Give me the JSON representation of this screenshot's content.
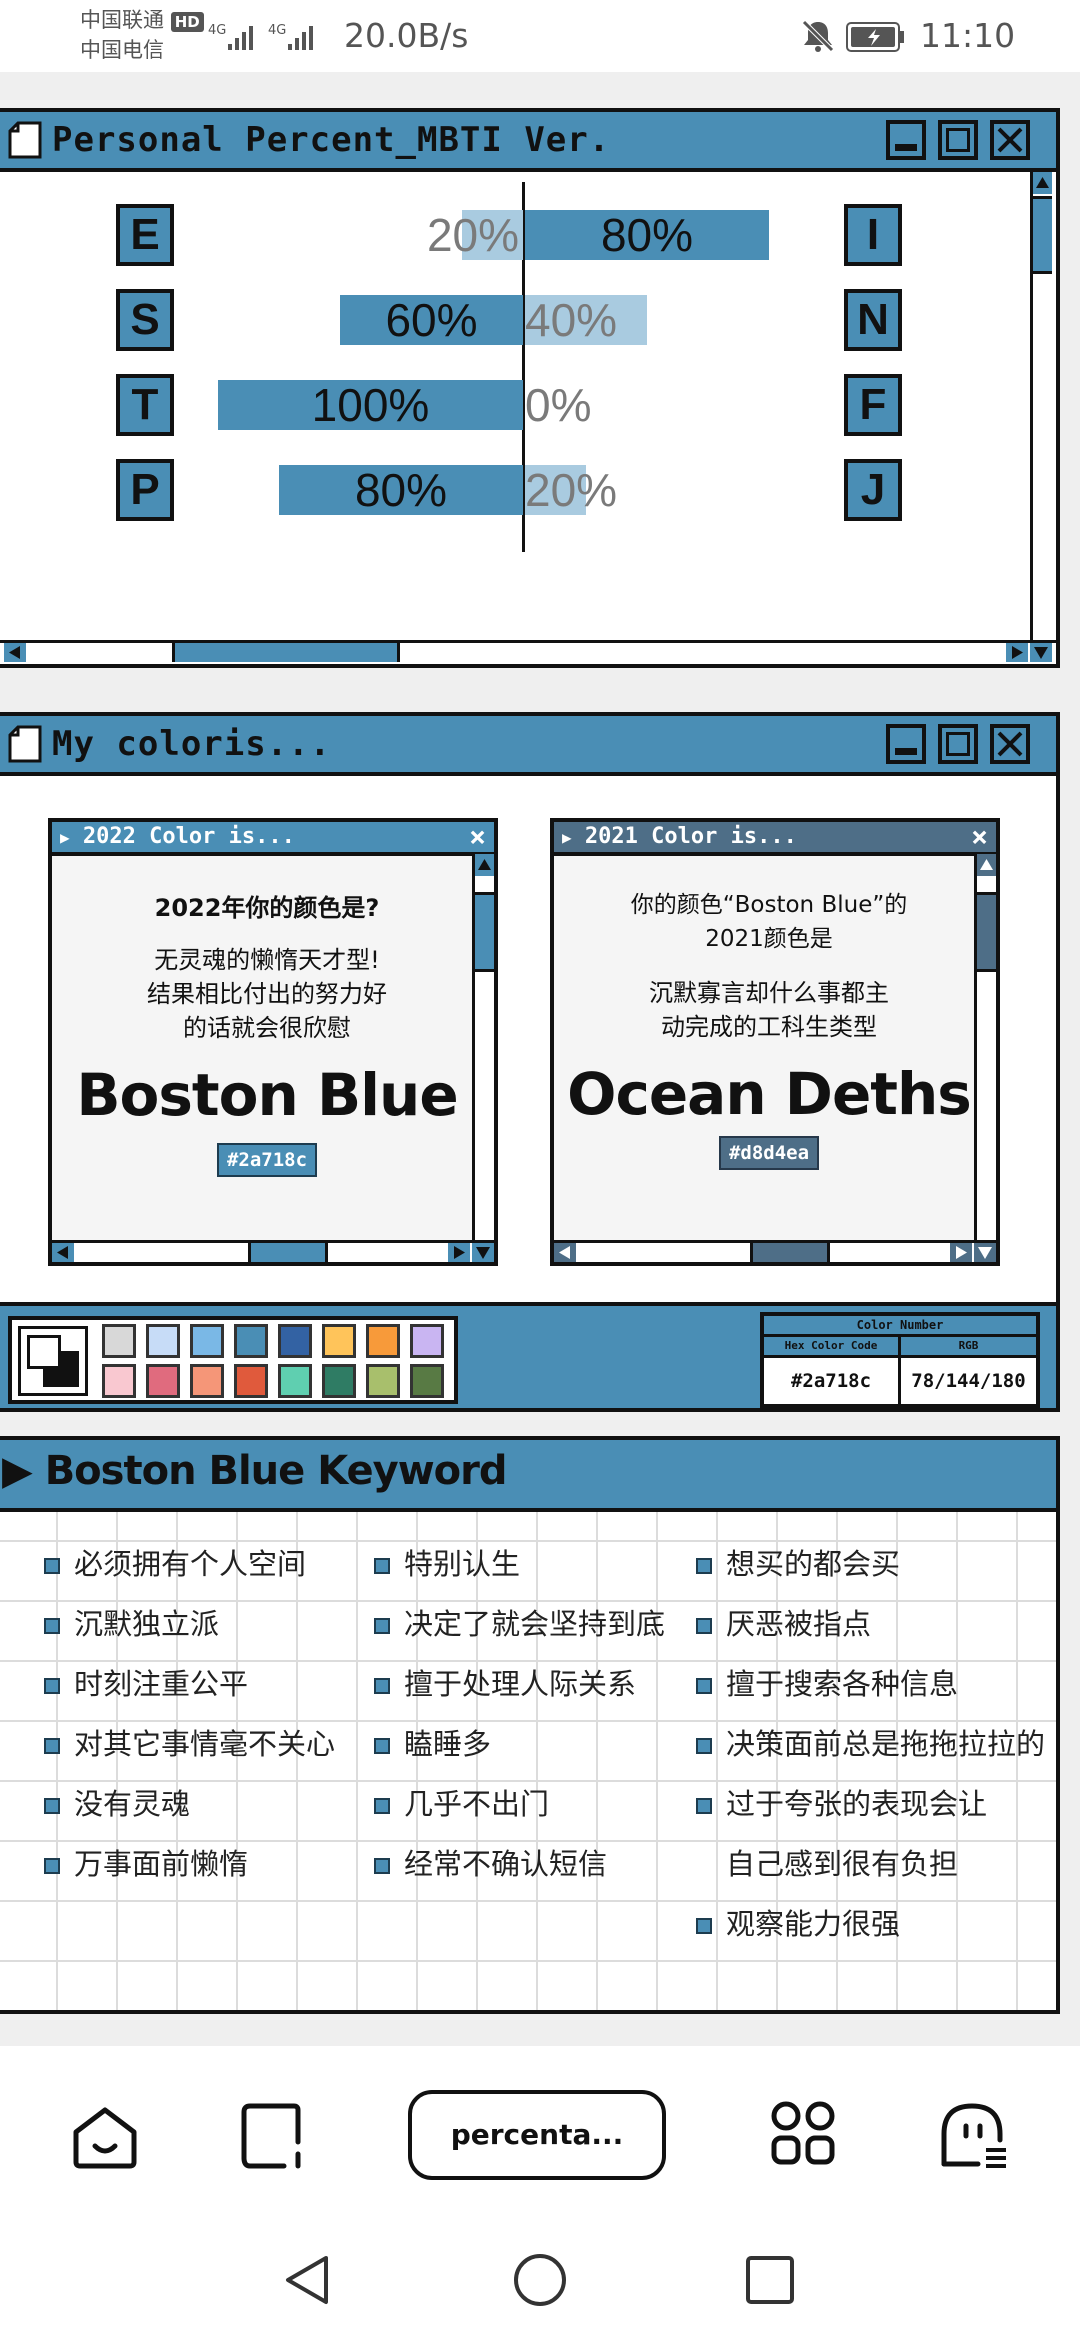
{
  "status_bar": {
    "carrier1": "中国联通",
    "hd": "HD",
    "carrier2": "中国电信",
    "net1": "4G",
    "net2": "4G",
    "speed": "20.0B/s",
    "time": "11:10"
  },
  "mbti_window": {
    "title": "Personal Percent_MBTI Ver.",
    "rows": [
      {
        "left": "E",
        "right": "I",
        "left_pct": "20%",
        "right_pct": "80%",
        "left_value": 20,
        "right_value": 80
      },
      {
        "left": "S",
        "right": "N",
        "left_pct": "60%",
        "right_pct": "40%",
        "left_value": 60,
        "right_value": 40
      },
      {
        "left": "T",
        "right": "F",
        "left_pct": "100%",
        "right_pct": "0%",
        "left_value": 100,
        "right_value": 0
      },
      {
        "left": "P",
        "right": "J",
        "left_pct": "80%",
        "right_pct": "20%",
        "left_value": 80,
        "right_value": 20
      }
    ],
    "colors": {
      "primary": "#4a8eb5",
      "secondary": "#a9cbe0"
    }
  },
  "color_window": {
    "title": "My coloris...",
    "card_2022": {
      "title": "2022 Color is...",
      "heading": "2022年你的颜色是?",
      "desc_lines": [
        "无灵魂的懒惰天才型!",
        "结果相比付出的努力好",
        "的话就会很欣慰"
      ],
      "name": "Boston Blue",
      "hex": "#2a718c",
      "header_color": "#4a8eb5"
    },
    "card_2021": {
      "title": "2021 Color is...",
      "heading_lines": [
        "你的颜色“Boston Blue”的",
        "2021颜色是"
      ],
      "desc_lines": [
        "沉默寡言却什么事都主",
        "动完成的工科生类型"
      ],
      "name": "Ocean Deths",
      "hex": "#d8d4ea",
      "header_color": "#4e6e87"
    }
  },
  "palette": {
    "swatches_row1": [
      "#d8d8d8",
      "#c7dcf7",
      "#7ab8e6",
      "#4a8eb5",
      "#3362a3",
      "#ffc45a",
      "#f79a3a",
      "#c9b5f2"
    ],
    "swatches_row2": [
      "#f9c8d0",
      "#e06b7e",
      "#f59678",
      "#e05a3c",
      "#5fcfb0",
      "#2f7c64",
      "#a8bf6c",
      "#587a44"
    ],
    "color_number_label": "Color Number",
    "hex_label": "Hex Color Code",
    "rgb_label": "RGB",
    "hex_value": "#2a718c",
    "rgb_value": "78/144/180"
  },
  "keywords": {
    "title": "▶ Boston Blue Keyword",
    "col1": [
      "必须拥有个人空间",
      "沉默独立派",
      "时刻注重公平",
      "对其它事情毫不关心",
      "没有灵魂",
      "万事面前懒惰"
    ],
    "col2": [
      "特别认生",
      "决定了就会坚持到底",
      "擅于处理人际关系",
      "瞌睡多",
      "几乎不出门",
      "经常不确认短信"
    ],
    "col3": [
      "想买的都会买",
      "厌恶被指点",
      "擅于搜索各种信息",
      "决策面前总是拖拖拉拉的",
      "过于夸张的表现会让",
      "自己感到很有负担",
      "观察能力很强"
    ]
  },
  "bottom_nav": {
    "tab_label": "percenta..."
  }
}
